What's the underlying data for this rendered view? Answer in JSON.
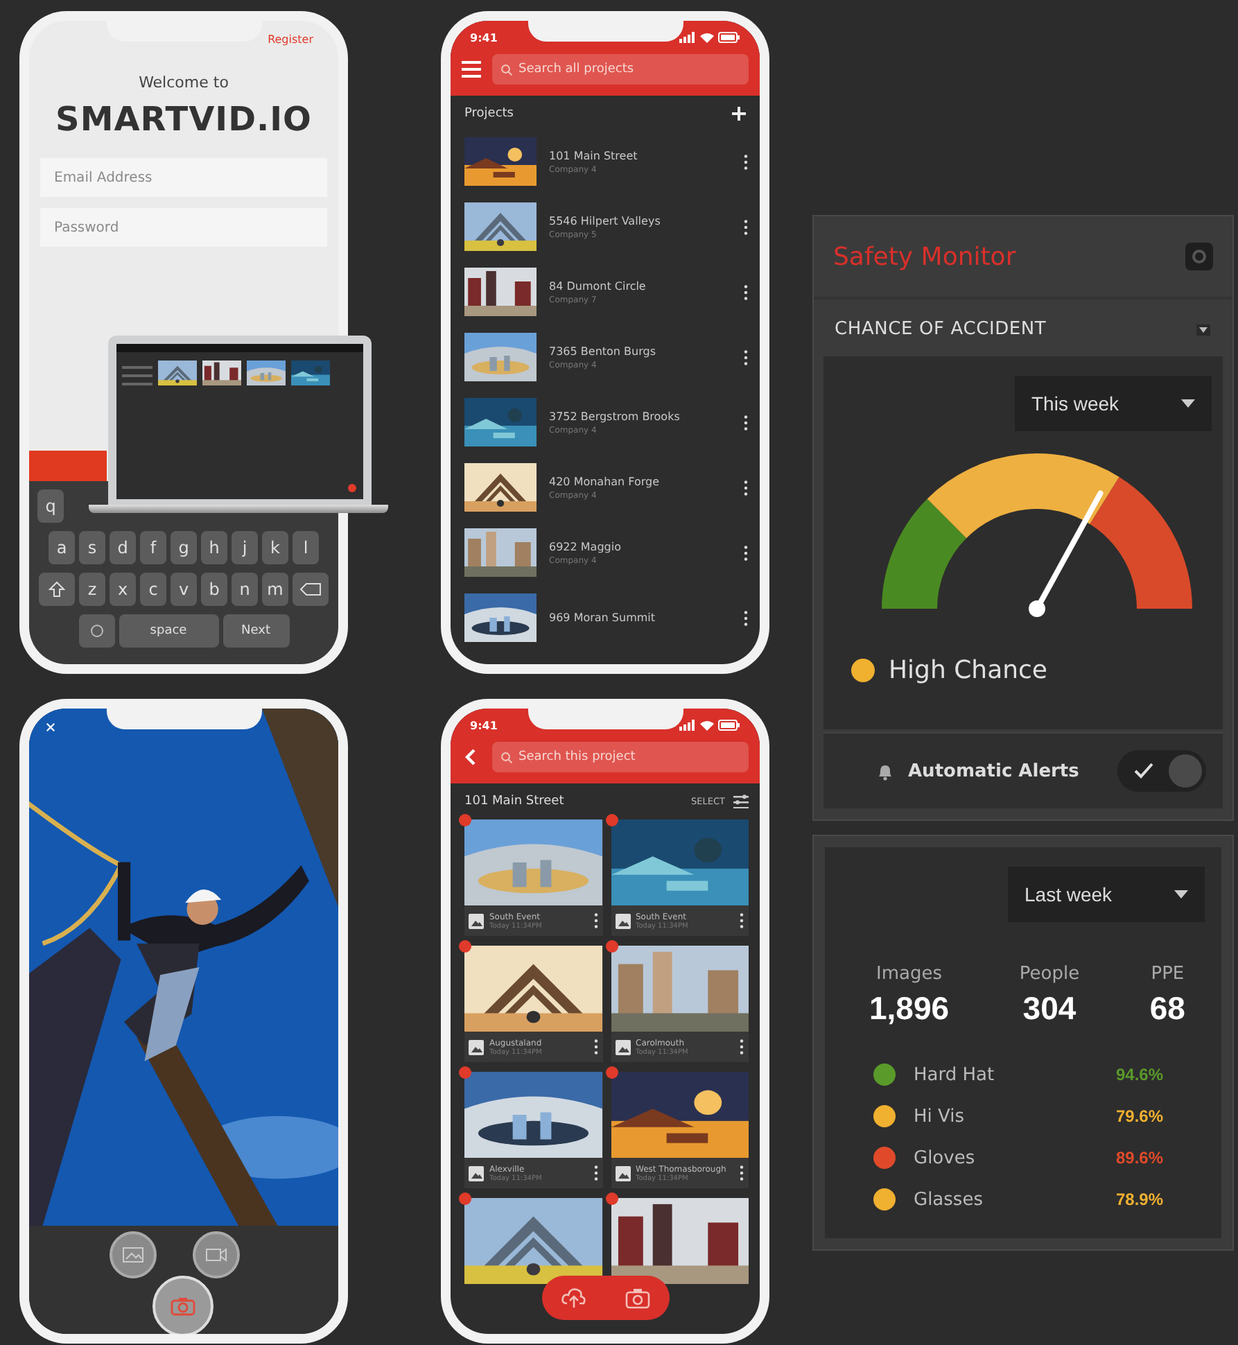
{
  "login_phone": {
    "register_link": "Register",
    "welcome": "Welcome to",
    "logo": "SMARTVID.IO",
    "email_placeholder": "Email Address",
    "password_placeholder": "Password",
    "keyboard": {
      "top_row": [
        "q"
      ],
      "home_row": [
        "a",
        "s",
        "d",
        "f",
        "g",
        "h",
        "j",
        "k",
        "l"
      ],
      "bottom_row": [
        "z",
        "x",
        "c",
        "v",
        "b",
        "n",
        "m"
      ],
      "space": "space",
      "action": "Next"
    }
  },
  "projects_phone": {
    "time": "9:41",
    "search_placeholder": "Search all projects",
    "heading": "Projects",
    "projects": [
      {
        "name": "101 Main Street",
        "subtitle": "Company 4"
      },
      {
        "name": "5546 Hilpert Valleys",
        "subtitle": "Company 5"
      },
      {
        "name": "84 Dumont Circle",
        "subtitle": "Company 7"
      },
      {
        "name": "7365 Benton Burgs",
        "subtitle": "Company 4"
      },
      {
        "name": "3752 Bergstrom Brooks",
        "subtitle": "Company 4"
      },
      {
        "name": "420 Monahan Forge",
        "subtitle": "Company 4"
      },
      {
        "name": "6922 Maggio",
        "subtitle": "Company 4"
      },
      {
        "name": "969 Moran Summit"
      }
    ]
  },
  "project_phone": {
    "time": "9:41",
    "search_placeholder": "Search this project",
    "title": "101 Main Street",
    "select_label": "SELECT",
    "photos": [
      {
        "title": "South Event",
        "subtitle": "Today 11:34PM"
      },
      {
        "title": "South Event",
        "subtitle": "Today 11:34PM"
      },
      {
        "title": "Augustaland",
        "subtitle": "Today 11:34PM"
      },
      {
        "title": "Carolmouth",
        "subtitle": "Today 11:34PM"
      },
      {
        "title": "Alexville",
        "subtitle": "Today 11:34PM"
      },
      {
        "title": "West Thomasborough",
        "subtitle": "Today 11:34PM"
      },
      {
        "kind": "picture"
      },
      {
        "kind": "picture"
      }
    ]
  },
  "safety_monitor": {
    "title": "Safety Monitor",
    "section": "CHANCE OF ACCIDENT",
    "period": "This week",
    "gauge": {
      "level": 0.66
    },
    "status": {
      "label": "High Chance",
      "color": "#f0b030"
    },
    "alerts": {
      "label": "Automatic Alerts",
      "on": true
    }
  },
  "ppe_card": {
    "period": "Last week",
    "stats": [
      {
        "label": "Images",
        "value": "1,896"
      },
      {
        "label": "People",
        "value": "304"
      },
      {
        "label": "PPE",
        "value": "68"
      }
    ],
    "items": [
      {
        "name": "Hard Hat",
        "value": "94.6%",
        "color": "#5a9a2a"
      },
      {
        "name": "Hi Vis",
        "value": "79.6%",
        "color": "#f0b030"
      },
      {
        "name": "Gloves",
        "value": "89.6%",
        "color": "#e04a2a"
      },
      {
        "name": "Glasses",
        "value": "78.9%",
        "color": "#f0b030"
      }
    ]
  }
}
